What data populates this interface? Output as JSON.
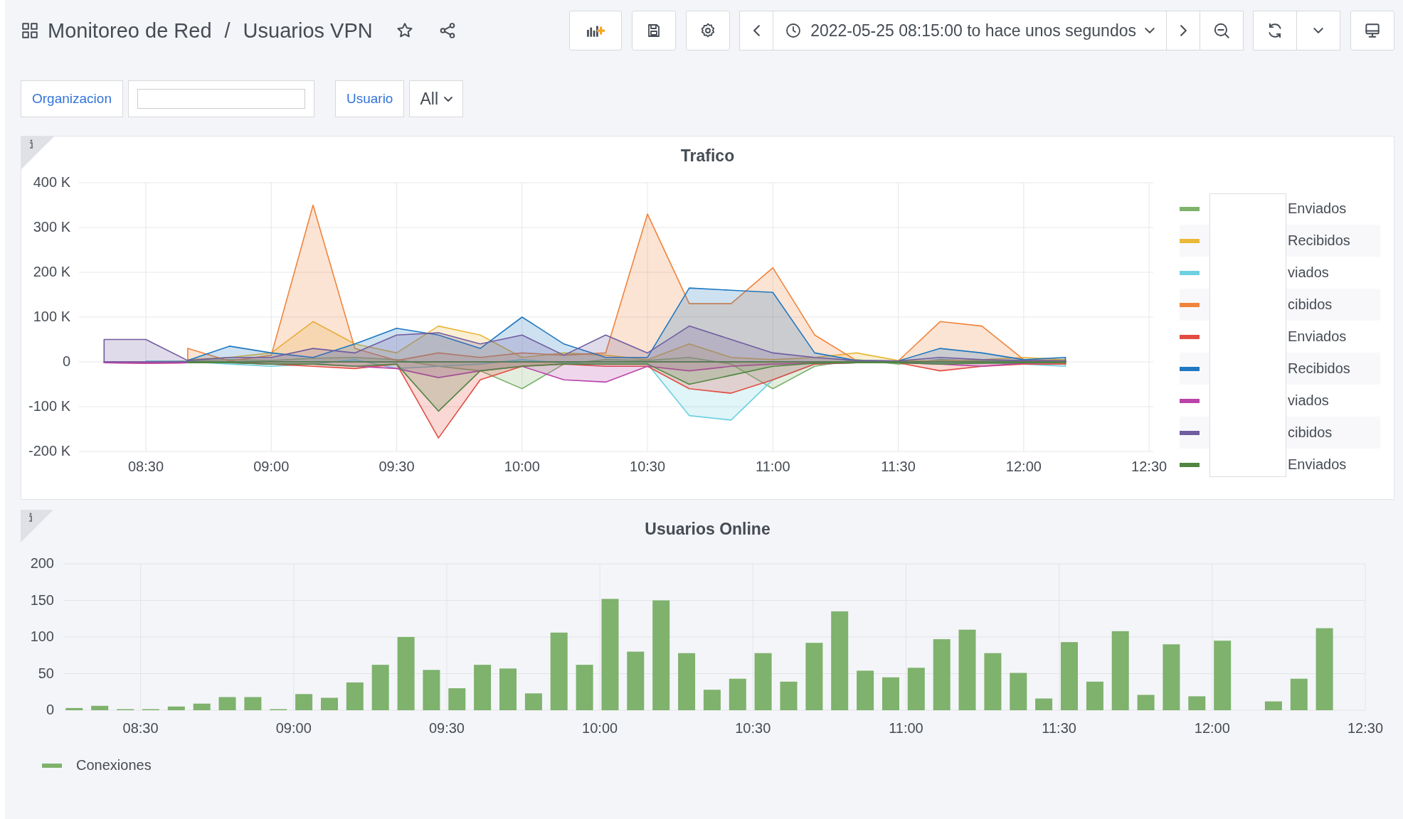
{
  "toolbar": {
    "title": "Monitoreo de Red",
    "separator": "/",
    "subtitle": "Usuarios VPN",
    "time_range": "2022-05-25 08:15:00 to hace unos segundos"
  },
  "variables": [
    {
      "kind": "text",
      "label": "Organizacion"
    },
    {
      "kind": "select",
      "label": "Usuario",
      "value": "All"
    }
  ],
  "panels": [
    {
      "title": "Trafico",
      "chart_data": {
        "type": "area",
        "grid": true,
        "xlim": [
          494,
          751
        ],
        "x": [
          500,
          510,
          520,
          530,
          540,
          550,
          560,
          570,
          580,
          590,
          600,
          610,
          620,
          630,
          640,
          650,
          660,
          670,
          680,
          690,
          700,
          710,
          720,
          730
        ],
        "ylim": [
          -200000,
          400000
        ],
        "yticks": [
          {
            "value": 400000,
            "label": "400 K"
          },
          {
            "value": 300000,
            "label": "300 K"
          },
          {
            "value": 200000,
            "label": "200 K"
          },
          {
            "value": 100000,
            "label": "100 K"
          },
          {
            "value": 0,
            "label": "0"
          },
          {
            "value": -100000,
            "label": "-100 K"
          },
          {
            "value": -200000,
            "label": "-200 K"
          }
        ],
        "xticks": [
          {
            "value": 510,
            "label": "08:30"
          },
          {
            "value": 540,
            "label": "09:00"
          },
          {
            "value": 570,
            "label": "09:30"
          },
          {
            "value": 600,
            "label": "10:00"
          },
          {
            "value": 630,
            "label": "10:30"
          },
          {
            "value": 660,
            "label": "11:00"
          },
          {
            "value": 690,
            "label": "11:30"
          },
          {
            "value": 720,
            "label": "12:00"
          },
          {
            "value": 750,
            "label": "12:30"
          }
        ],
        "series": [
          {
            "name": "Enviados",
            "color": "#7eb26d",
            "values": [
              null,
              1000,
              2000,
              5000,
              3000,
              8000,
              10000,
              5000,
              -10000,
              -20000,
              -60000,
              -5000,
              5000,
              3000,
              10000,
              -5000,
              -60000,
              -10000,
              5000,
              -5000,
              5000,
              2000,
              3000,
              2000
            ]
          },
          {
            "name": "Recibidos",
            "color": "#eab839",
            "values": [
              null,
              null,
              5000,
              10000,
              20000,
              90000,
              40000,
              20000,
              80000,
              60000,
              10000,
              20000,
              15000,
              5000,
              40000,
              10000,
              5000,
              10000,
              20000,
              3000,
              2000,
              5000,
              10000,
              5000
            ]
          },
          {
            "name": "viados",
            "color": "#6ed0e0",
            "values": [
              null,
              2000,
              1000,
              -5000,
              -10000,
              -5000,
              5000,
              -15000,
              -10000,
              -5000,
              5000,
              -3000,
              -5000,
              -5000,
              -120000,
              -130000,
              -40000,
              -5000,
              -2000,
              -2000,
              -3000,
              -2000,
              -5000,
              -10000
            ]
          },
          {
            "name": "cibidos",
            "color": "#ef843c",
            "values": [
              null,
              null,
              30000,
              2000,
              15000,
              350000,
              30000,
              3000,
              20000,
              10000,
              20000,
              15000,
              20000,
              330000,
              130000,
              130000,
              210000,
              60000,
              3000,
              2000,
              90000,
              80000,
              5000,
              3000
            ]
          },
          {
            "name": "Enviados",
            "color": "#e24d42",
            "values": [
              -2000,
              -3000,
              -2000,
              -1000,
              -5000,
              -10000,
              -15000,
              -5000,
              -170000,
              -40000,
              -10000,
              -5000,
              -10000,
              -10000,
              -60000,
              -70000,
              -40000,
              -5000,
              -2000,
              -2000,
              -20000,
              -10000,
              -5000,
              -5000
            ]
          },
          {
            "name": "Recibidos",
            "color": "#1f78c1",
            "values": [
              null,
              null,
              3000,
              35000,
              20000,
              10000,
              40000,
              75000,
              60000,
              30000,
              100000,
              40000,
              10000,
              10000,
              165000,
              160000,
              155000,
              20000,
              3000,
              2000,
              30000,
              20000,
              5000,
              10000
            ]
          },
          {
            "name": "viados",
            "color": "#ba43a9",
            "values": [
              -2000,
              -3000,
              -2000,
              -2000,
              -5000,
              -5000,
              -10000,
              -15000,
              -35000,
              -20000,
              -10000,
              -40000,
              -45000,
              -10000,
              -20000,
              -10000,
              -5000,
              -3000,
              -2000,
              -2000,
              -5000,
              -10000,
              -3000,
              -2000
            ]
          },
          {
            "name": "cibidos",
            "color": "#705da0",
            "values": [
              50000,
              50000,
              3000,
              10000,
              10000,
              30000,
              20000,
              60000,
              65000,
              40000,
              60000,
              15000,
              60000,
              20000,
              80000,
              50000,
              20000,
              10000,
              3000,
              2000,
              10000,
              5000,
              3000,
              2000
            ]
          },
          {
            "name": "Enviados",
            "color": "#508642",
            "values": [
              null,
              null,
              -2000,
              -2000,
              -5000,
              -5000,
              -10000,
              -5000,
              -110000,
              -20000,
              -10000,
              -5000,
              -5000,
              -5000,
              -50000,
              -30000,
              -10000,
              -3000,
              -2000,
              -2000,
              -5000,
              -3000,
              -2000,
              -2000
            ]
          }
        ]
      }
    },
    {
      "title": "Usuarios Online",
      "chart_data": {
        "type": "bar",
        "grid": true,
        "xlim": [
          495,
          750
        ],
        "x": [
          497,
          502,
          507,
          512,
          517,
          522,
          527,
          532,
          537,
          542,
          547,
          552,
          557,
          562,
          567,
          572,
          577,
          582,
          587,
          592,
          597,
          602,
          607,
          612,
          617,
          622,
          627,
          632,
          637,
          642,
          647,
          652,
          657,
          662,
          667,
          672,
          677,
          682,
          687,
          692,
          697,
          702,
          707,
          712,
          717,
          722,
          727,
          732,
          737,
          742
        ],
        "ylim": [
          0,
          200
        ],
        "yticks": [
          0,
          50,
          100,
          150,
          200
        ],
        "xticks": [
          {
            "value": 510,
            "label": "08:30"
          },
          {
            "value": 540,
            "label": "09:00"
          },
          {
            "value": 570,
            "label": "09:30"
          },
          {
            "value": 600,
            "label": "10:00"
          },
          {
            "value": 630,
            "label": "10:30"
          },
          {
            "value": 660,
            "label": "11:00"
          },
          {
            "value": 690,
            "label": "11:30"
          },
          {
            "value": 720,
            "label": "12:00"
          },
          {
            "value": 750,
            "label": "12:30"
          }
        ],
        "series": [
          {
            "name": "Conexiones",
            "color": "#7eb26d",
            "values": [
              3,
              6,
              1,
              1,
              5,
              9,
              18,
              18,
              1,
              22,
              17,
              38,
              62,
              100,
              55,
              30,
              62,
              57,
              23,
              106,
              62,
              152,
              80,
              150,
              78,
              28,
              43,
              78,
              39,
              92,
              135,
              54,
              45,
              58,
              97,
              110,
              78,
              51,
              16,
              93,
              39,
              108,
              21,
              90,
              19,
              95,
              null,
              12,
              43,
              112
            ]
          }
        ]
      }
    }
  ]
}
